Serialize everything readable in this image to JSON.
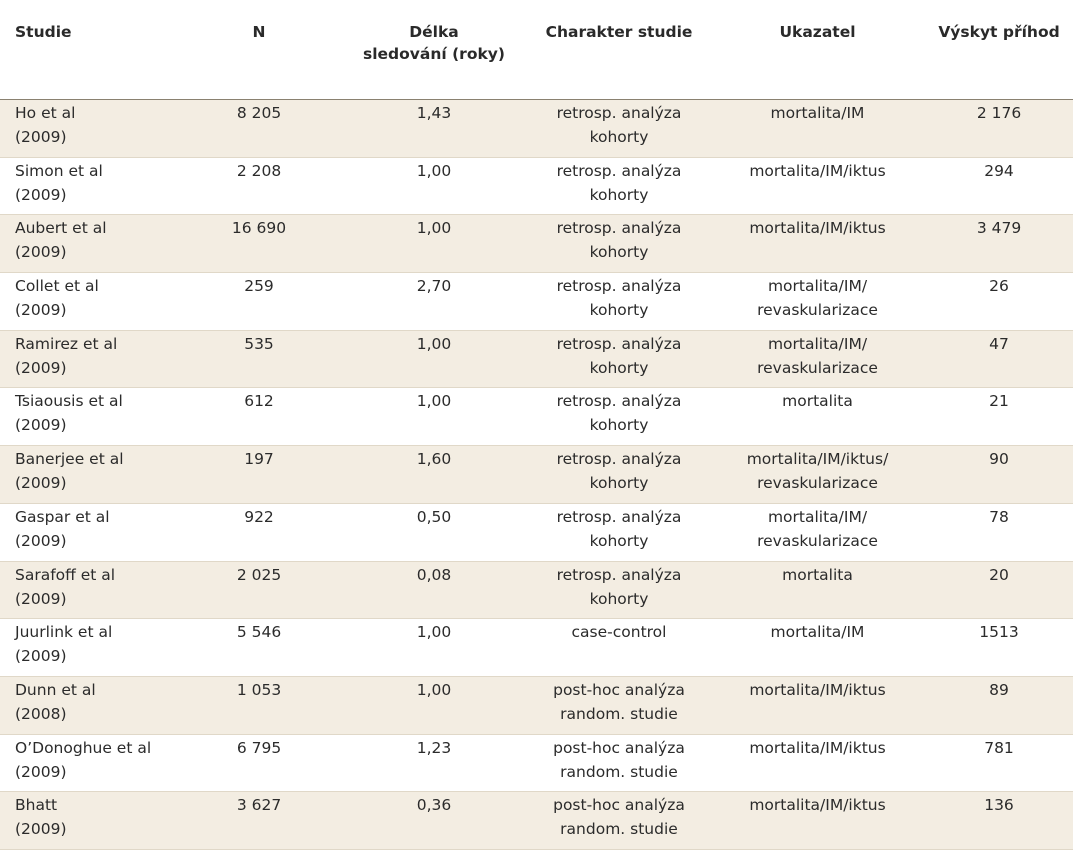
{
  "headers": {
    "studie": "Studie",
    "n": "N",
    "delka_1": "Délka",
    "delka_2": "sledování (roky)",
    "charakter": "Charakter studie",
    "ukazatel": "Ukazatel",
    "vyskyt": "Výskyt příhod"
  },
  "rows": [
    {
      "name": "Ho et al",
      "year": "(2009)",
      "n": "8 205",
      "delka": "1,43",
      "charakter_1": "retrosp. analýza",
      "charakter_2": "kohorty",
      "ukazatel_1": "mortalita/IM",
      "ukazatel_2": "",
      "vyskyt": "2 176"
    },
    {
      "name": "Simon et al",
      "year": "(2009)",
      "n": "2 208",
      "delka": "1,00",
      "charakter_1": "retrosp. analýza",
      "charakter_2": "kohorty",
      "ukazatel_1": "mortalita/IM/iktus",
      "ukazatel_2": "",
      "vyskyt": "294"
    },
    {
      "name": "Aubert et al",
      "year": "(2009)",
      "n": "16 690",
      "delka": "1,00",
      "charakter_1": "retrosp. analýza",
      "charakter_2": "kohorty",
      "ukazatel_1": "mortalita/IM/iktus",
      "ukazatel_2": "",
      "vyskyt": "3 479"
    },
    {
      "name": "Collet et al",
      "year": "(2009)",
      "n": "259",
      "delka": "2,70",
      "charakter_1": "retrosp. analýza",
      "charakter_2": "kohorty",
      "ukazatel_1": "mortalita/IM/",
      "ukazatel_2": "revaskularizace",
      "vyskyt": "26"
    },
    {
      "name": "Ramirez et al",
      "year": "(2009)",
      "n": "535",
      "delka": "1,00",
      "charakter_1": "retrosp. analýza",
      "charakter_2": "kohorty",
      "ukazatel_1": "mortalita/IM/",
      "ukazatel_2": "revaskularizace",
      "vyskyt": "47"
    },
    {
      "name": "Tsiaousis et al",
      "year": "(2009)",
      "n": "612",
      "delka": "1,00",
      "charakter_1": "retrosp. analýza",
      "charakter_2": "kohorty",
      "ukazatel_1": "mortalita",
      "ukazatel_2": "",
      "vyskyt": "21"
    },
    {
      "name": "Banerjee et al",
      "year": "(2009)",
      "n": "197",
      "delka": "1,60",
      "charakter_1": "retrosp. analýza",
      "charakter_2": "kohorty",
      "ukazatel_1": "mortalita/IM/iktus/",
      "ukazatel_2": "revaskularizace",
      "vyskyt": "90"
    },
    {
      "name": "Gaspar et al",
      "year": "(2009)",
      "n": "922",
      "delka": "0,50",
      "charakter_1": "retrosp. analýza",
      "charakter_2": "kohorty",
      "ukazatel_1": "mortalita/IM/",
      "ukazatel_2": "revaskularizace",
      "vyskyt": "78"
    },
    {
      "name": "Sarafoff et al",
      "year": "(2009)",
      "n": "2 025",
      "delka": "0,08",
      "charakter_1": "retrosp. analýza",
      "charakter_2": "kohorty",
      "ukazatel_1": "mortalita",
      "ukazatel_2": "",
      "vyskyt": "20"
    },
    {
      "name": "Juurlink et al",
      "year": "(2009)",
      "n": "5 546",
      "delka": "1,00",
      "charakter_1": "case-control",
      "charakter_2": "",
      "ukazatel_1": "mortalita/IM",
      "ukazatel_2": "",
      "vyskyt": "1513"
    },
    {
      "name": "Dunn et al",
      "year": "(2008)",
      "n": "1 053",
      "delka": "1,00",
      "charakter_1": "post-hoc analýza",
      "charakter_2": "random. studie",
      "ukazatel_1": "mortalita/IM/iktus",
      "ukazatel_2": "",
      "vyskyt": "89"
    },
    {
      "name": "O’Donoghue et al",
      "year": "(2009)",
      "n": "6 795",
      "delka": "1,23",
      "charakter_1": "post-hoc analýza",
      "charakter_2": "random. studie",
      "ukazatel_1": "mortalita/IM/iktus",
      "ukazatel_2": "",
      "vyskyt": "781"
    },
    {
      "name": "Bhatt",
      "year": "(2009)",
      "n": "3 627",
      "delka": "0,36",
      "charakter_1": "post-hoc analýza",
      "charakter_2": "random. studie",
      "ukazatel_1": "mortalita/IM/iktus",
      "ukazatel_2": "",
      "vyskyt": "136"
    }
  ]
}
